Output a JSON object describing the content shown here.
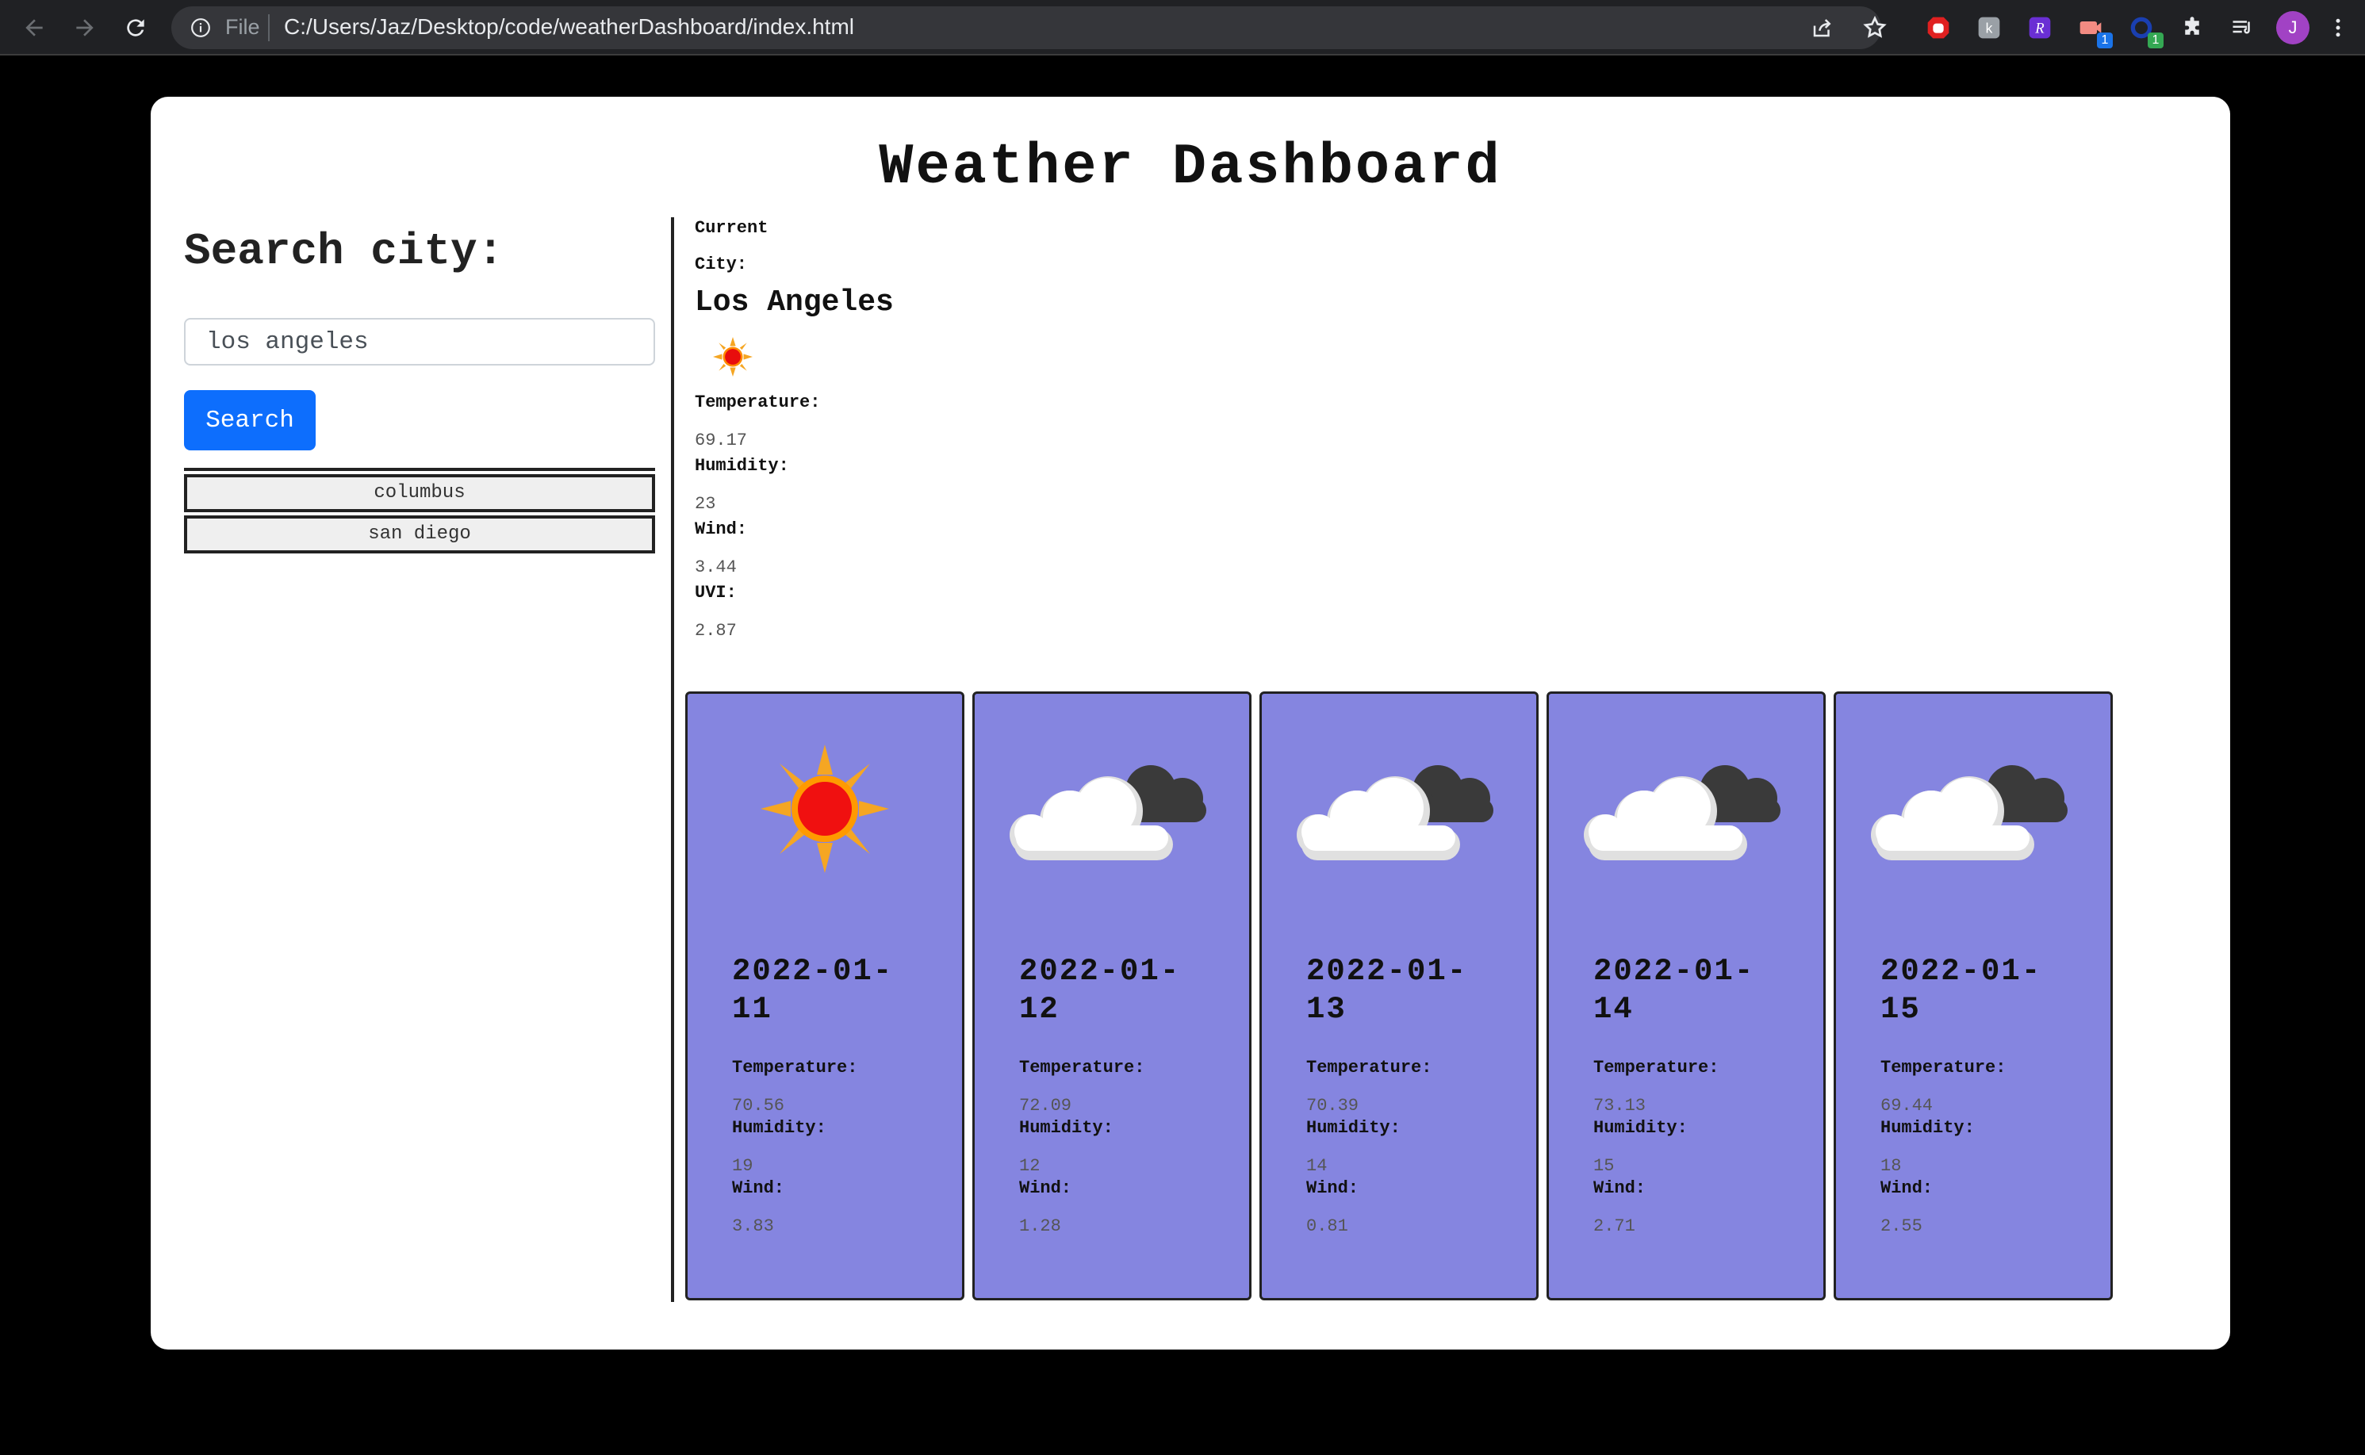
{
  "browser": {
    "scheme_label": "File",
    "url": "C:/Users/Jaz/Desktop/code/weatherDashboard/index.html",
    "extension_badges": [
      "1",
      "1"
    ],
    "profile_initial": "J"
  },
  "page": {
    "title": "Weather Dashboard"
  },
  "search": {
    "heading": "Search city:",
    "input_value": "los angeles",
    "button_label": "Search",
    "history": [
      "columbus",
      "san diego"
    ]
  },
  "current": {
    "heading": "Current",
    "city_label": "City:",
    "city_name": "Los Angeles",
    "icon": "sun-icon",
    "temperature_label": "Temperature:",
    "temperature": "69.17",
    "humidity_label": "Humidity:",
    "humidity": "23",
    "wind_label": "Wind:",
    "wind": "3.44",
    "uvi_label": "UVI:",
    "uvi": "2.87"
  },
  "forecast": [
    {
      "date_line1": "2022-01-",
      "date_line2": "11",
      "icon": "sun-icon",
      "temperature_label": "Temperature:",
      "temperature": "70.56",
      "humidity_label": "Humidity:",
      "humidity": "19",
      "wind_label": "Wind:",
      "wind": "3.83"
    },
    {
      "date_line1": "2022-01-",
      "date_line2": "12",
      "icon": "cloudy-icon",
      "temperature_label": "Temperature:",
      "temperature": "72.09",
      "humidity_label": "Humidity:",
      "humidity": "12",
      "wind_label": "Wind:",
      "wind": "1.28"
    },
    {
      "date_line1": "2022-01-",
      "date_line2": "13",
      "icon": "cloudy-icon",
      "temperature_label": "Temperature:",
      "temperature": "70.39",
      "humidity_label": "Humidity:",
      "humidity": "14",
      "wind_label": "Wind:",
      "wind": "0.81"
    },
    {
      "date_line1": "2022-01-",
      "date_line2": "14",
      "icon": "cloudy-icon",
      "temperature_label": "Temperature:",
      "temperature": "73.13",
      "humidity_label": "Humidity:",
      "humidity": "15",
      "wind_label": "Wind:",
      "wind": "2.71"
    },
    {
      "date_line1": "2022-01-",
      "date_line2": "15",
      "icon": "cloudy-icon",
      "temperature_label": "Temperature:",
      "temperature": "69.44",
      "humidity_label": "Humidity:",
      "humidity": "18",
      "wind_label": "Wind:",
      "wind": "2.55"
    }
  ],
  "colors": {
    "card_background": "#8585e0",
    "search_button": "#0d6efd",
    "page_background": "#000000"
  }
}
